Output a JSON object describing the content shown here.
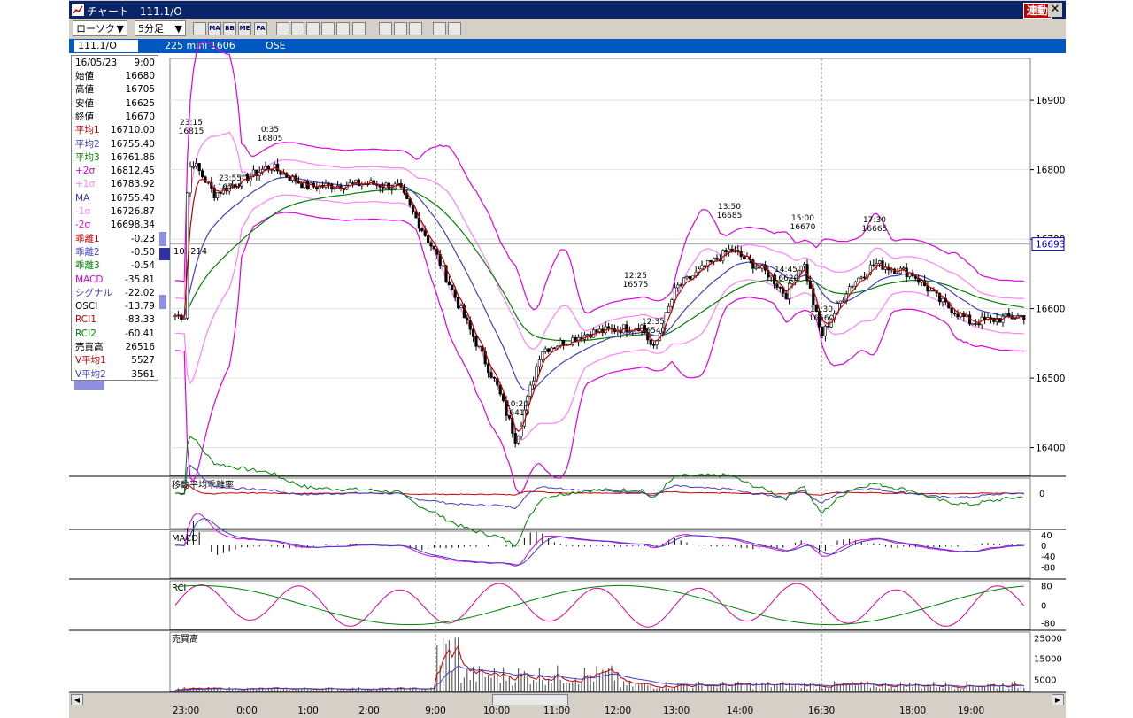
{
  "window": {
    "title": "チャート　111.1/O",
    "sync_label": "連動",
    "close_symbol": "✕"
  },
  "toolbar": {
    "chart_type": "ローソク",
    "interval": "5分足",
    "dropdown_arrow": "▼",
    "buttons": [
      {
        "icon": "settings-icon",
        "label": ""
      },
      {
        "icon": "ma-icon",
        "label": "MA"
      },
      {
        "icon": "bb-icon",
        "label": "BB"
      },
      {
        "icon": "me-icon",
        "label": "ME"
      },
      {
        "icon": "pa-icon",
        "label": "PA"
      },
      {
        "icon": "line-chart-icon",
        "label": ""
      },
      {
        "icon": "candle-icon",
        "label": ""
      },
      {
        "icon": "zigzag-icon",
        "label": ""
      },
      {
        "icon": "zoom-icon",
        "label": ""
      },
      {
        "icon": "table-icon",
        "label": ""
      },
      {
        "icon": "bars-icon",
        "label": ""
      },
      {
        "icon": "pen-icon",
        "label": ""
      },
      {
        "icon": "cursor-icon",
        "label": ""
      },
      {
        "icon": "eraser-icon",
        "label": ""
      },
      {
        "icon": "search-icon",
        "label": ""
      },
      {
        "icon": "fibonacci-icon",
        "label": ""
      }
    ]
  },
  "infobar": {
    "symbol": "111.1/O",
    "description": "225 mini 1606",
    "exchange": "OSE"
  },
  "data_panel": {
    "date": "16/05/23",
    "time": "9:00",
    "rows": [
      {
        "k": "始値",
        "v": "16680",
        "c": "#000000"
      },
      {
        "k": "高値",
        "v": "16705",
        "c": "#000000"
      },
      {
        "k": "安値",
        "v": "16625",
        "c": "#000000"
      },
      {
        "k": "終値",
        "v": "16670",
        "c": "#000000"
      },
      {
        "k": "平均1",
        "v": "16710.00",
        "c": "#c00000"
      },
      {
        "k": "平均2",
        "v": "16755.40",
        "c": "#4040c0"
      },
      {
        "k": "平均3",
        "v": "16761.86",
        "c": "#008000"
      },
      {
        "k": "+2σ",
        "v": "16812.45",
        "c": "#e000e0"
      },
      {
        "k": "+1σ",
        "v": "16783.92",
        "c": "#ff80ff"
      },
      {
        "k": "MA",
        "v": "16755.40",
        "c": "#4040c0"
      },
      {
        "k": "-1σ",
        "v": "16726.87",
        "c": "#ff80ff"
      },
      {
        "k": "-2σ",
        "v": "16698.34",
        "c": "#e000e0"
      },
      {
        "k": "乖離1",
        "v": "-0.23",
        "c": "#c00000"
      },
      {
        "k": "乖離2",
        "v": "-0.50",
        "c": "#4040c0"
      },
      {
        "k": "乖離3",
        "v": "-0.54",
        "c": "#008000"
      },
      {
        "k": "MACD",
        "v": "-35.81",
        "c": "#e000e0"
      },
      {
        "k": "シグナル",
        "v": "-22.02",
        "c": "#4040c0"
      },
      {
        "k": "OSCI",
        "v": "-13.79",
        "c": "#000000"
      },
      {
        "k": "RCI1",
        "v": "-83.33",
        "c": "#c00000"
      },
      {
        "k": "RCI2",
        "v": "-60.41",
        "c": "#008000"
      },
      {
        "k": "売買高",
        "v": "26516",
        "c": "#000000"
      },
      {
        "k": "V平均1",
        "v": "5527",
        "c": "#c00000"
      },
      {
        "k": "V平均2",
        "v": "3561",
        "c": "#4040c0"
      }
    ]
  },
  "price_current": "16693",
  "volume_profile_label": "105214",
  "panels": {
    "deviation_title": "移動平均乖離率",
    "macd_title": "MACD",
    "rci_title": "RCI",
    "volume_title": "売買高"
  },
  "price_axis_labels": [
    "16900",
    "16800",
    "16700",
    "16600",
    "16500",
    "16400"
  ],
  "deviation_axis_labels": [
    "0"
  ],
  "macd_axis_labels": [
    "40",
    "0",
    "-40",
    "-80"
  ],
  "rci_axis_labels": [
    "80",
    "0",
    "-80"
  ],
  "volume_axis_labels": [
    "25000",
    "15000",
    "5000"
  ],
  "time_labels": [
    "23:00",
    "0:00",
    "1:00",
    "2:00",
    "9:00",
    "10:00",
    "11:00",
    "12:00",
    "13:00",
    "14:00",
    "16:30",
    "18:00",
    "19:00"
  ],
  "annotations": [
    {
      "time": "23:15",
      "price": "16815"
    },
    {
      "time": "0:35",
      "price": "16805"
    },
    {
      "time": "23:55",
      "price": "16765"
    },
    {
      "time": "13:50",
      "price": "16685"
    },
    {
      "time": "15:00",
      "price": "16670"
    },
    {
      "time": "17:30",
      "price": "16665"
    },
    {
      "time": "12:25",
      "price": "16575"
    },
    {
      "time": "14:45",
      "price": "16620"
    },
    {
      "time": "12:35",
      "price": "16540"
    },
    {
      "time": "16:30",
      "price": "16560"
    },
    {
      "time": "10:20",
      "price": "16410"
    }
  ],
  "colors": {
    "titlebar": "#0a246a",
    "infobar": "#0058c0",
    "ma1": "#c00000",
    "ma2": "#4040c0",
    "ma3": "#008000",
    "bb2": "#e000e0",
    "bb1": "#ff80ff"
  },
  "chart_data": {
    "type": "candlestick",
    "symbol": "111.1/O",
    "interval": "5分足",
    "y_range": [
      16360,
      16960
    ],
    "key_points": [
      {
        "t": "23:00",
        "price": 16750
      },
      {
        "t": "23:15",
        "price": 16815
      },
      {
        "t": "23:55",
        "price": 16765
      },
      {
        "t": "0:35",
        "price": 16805
      },
      {
        "t": "1:00",
        "price": 16775
      },
      {
        "t": "2:00",
        "price": 16780
      },
      {
        "t": "2:30",
        "price": 16775
      },
      {
        "t": "9:00",
        "price": 16680
      },
      {
        "t": "9:30",
        "price": 16580
      },
      {
        "t": "10:00",
        "price": 16490
      },
      {
        "t": "10:20",
        "price": 16410
      },
      {
        "t": "10:50",
        "price": 16540
      },
      {
        "t": "11:30",
        "price": 16565
      },
      {
        "t": "12:25",
        "price": 16575
      },
      {
        "t": "12:35",
        "price": 16540
      },
      {
        "t": "13:00",
        "price": 16630
      },
      {
        "t": "13:50",
        "price": 16685
      },
      {
        "t": "14:30",
        "price": 16650
      },
      {
        "t": "14:45",
        "price": 16620
      },
      {
        "t": "15:00",
        "price": 16670
      },
      {
        "t": "16:30",
        "price": 16560
      },
      {
        "t": "17:00",
        "price": 16630
      },
      {
        "t": "17:30",
        "price": 16665
      },
      {
        "t": "18:00",
        "price": 16650
      },
      {
        "t": "18:30",
        "price": 16610
      },
      {
        "t": "19:00",
        "price": 16580
      },
      {
        "t": "19:40",
        "price": 16590
      }
    ]
  }
}
